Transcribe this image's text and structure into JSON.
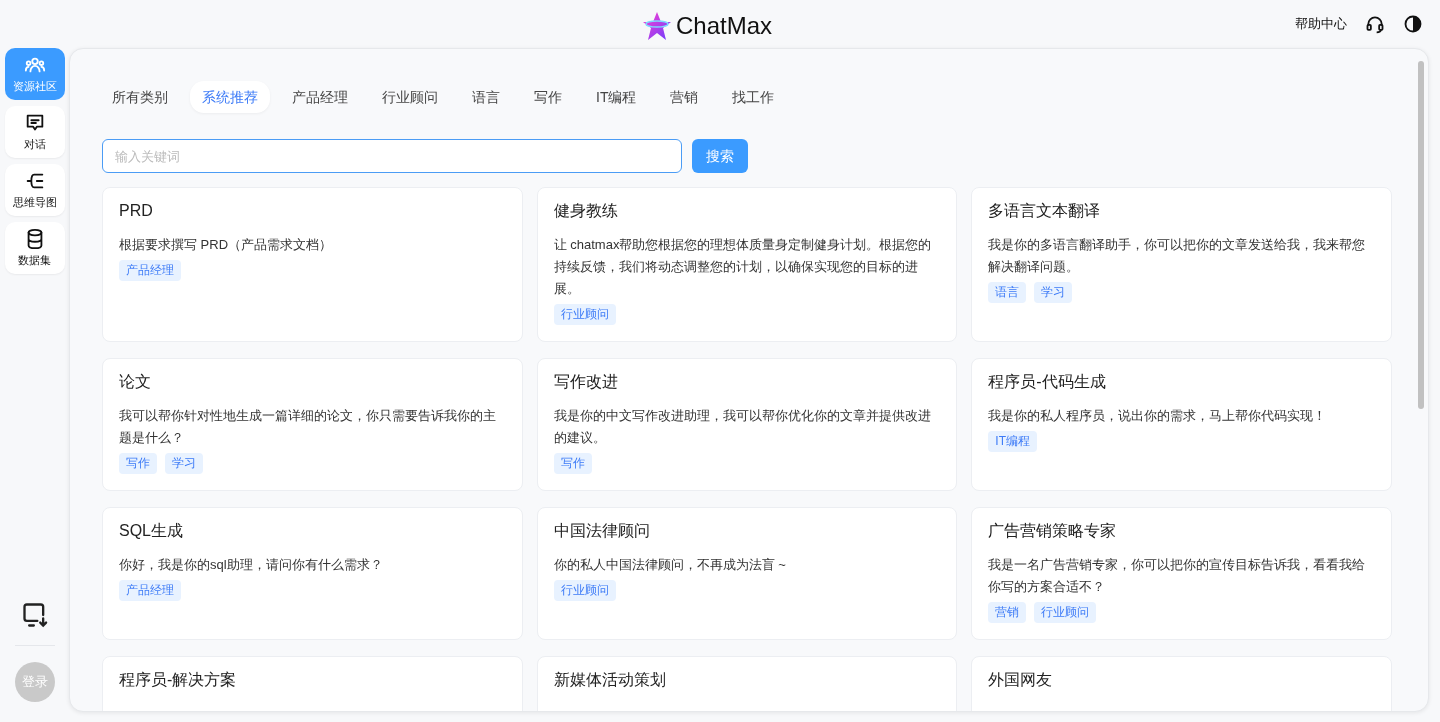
{
  "header": {
    "logo_text": "ChatMax",
    "help": "帮助中心"
  },
  "sidebar": {
    "items": [
      {
        "kind": "community",
        "label": "资源社区",
        "selected": true
      },
      {
        "kind": "chat",
        "label": "对话",
        "selected": false
      },
      {
        "kind": "mindmap",
        "label": "思维导图",
        "selected": false
      },
      {
        "kind": "dataset",
        "label": "数据集",
        "selected": false
      }
    ],
    "login": "登录"
  },
  "tabs": [
    {
      "label": "所有类别",
      "selected": false
    },
    {
      "label": "系统推荐",
      "selected": true
    },
    {
      "label": "产品经理",
      "selected": false
    },
    {
      "label": "行业顾问",
      "selected": false
    },
    {
      "label": "语言",
      "selected": false
    },
    {
      "label": "写作",
      "selected": false
    },
    {
      "label": "IT编程",
      "selected": false
    },
    {
      "label": "营销",
      "selected": false
    },
    {
      "label": "找工作",
      "selected": false
    }
  ],
  "search": {
    "placeholder": "输入关键词",
    "button": "搜索"
  },
  "cards": [
    {
      "title": "PRD",
      "description": "根据要求撰写 PRD（产品需求文档）",
      "tags": [
        "产品经理"
      ]
    },
    {
      "title": "健身教练",
      "description": "让 chatmax帮助您根据您的理想体质量身定制健身计划。根据您的持续反馈，我们将动态调整您的计划，以确保实现您的目标的进展。",
      "tags": [
        "行业顾问"
      ]
    },
    {
      "title": "多语言文本翻译",
      "description": "我是你的多语言翻译助手，你可以把你的文章发送给我，我来帮您解决翻译问题。",
      "tags": [
        "语言",
        "学习"
      ]
    },
    {
      "title": "论文",
      "description": "我可以帮你针对性地生成一篇详细的论文，你只需要告诉我你的主题是什么？",
      "tags": [
        "写作",
        "学习"
      ]
    },
    {
      "title": "写作改进",
      "description": "我是你的中文写作改进助理，我可以帮你优化你的文章并提供改进的建议。",
      "tags": [
        "写作"
      ]
    },
    {
      "title": "程序员-代码生成",
      "description": "我是你的私人程序员，说出你的需求，马上帮你代码实现！",
      "tags": [
        "IT编程"
      ]
    },
    {
      "title": "SQL生成",
      "description": "你好，我是你的sql助理，请问你有什么需求？",
      "tags": [
        "产品经理"
      ]
    },
    {
      "title": "中国法律顾问",
      "description": "你的私人中国法律顾问，不再成为法盲 ~",
      "tags": [
        "行业顾问"
      ]
    },
    {
      "title": "广告营销策略专家",
      "description": "我是一名广告营销专家，你可以把你的宣传目标告诉我，看看我给你写的方案合适不？",
      "tags": [
        "营销",
        "行业顾问"
      ]
    },
    {
      "title": "程序员-解决方案"
    },
    {
      "title": "新媒体活动策划"
    },
    {
      "title": "外国网友"
    }
  ]
}
